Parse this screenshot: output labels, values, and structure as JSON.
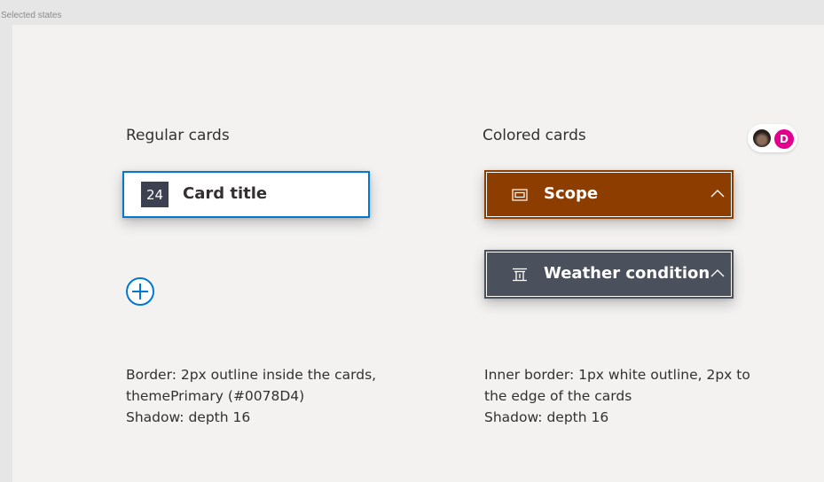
{
  "frame_label": "Selected states",
  "regular": {
    "heading": "Regular cards",
    "card": {
      "count": "24",
      "title": "Card title"
    },
    "notes": [
      "Border: 2px outline inside the cards,",
      "themePrimary (#0078D4)",
      "Shadow: depth 16"
    ]
  },
  "colored": {
    "heading": "Colored cards",
    "cards": [
      {
        "title": "Scope",
        "icon": "scope-icon",
        "color": "#8e3d00"
      },
      {
        "title": "Weather condition",
        "icon": "weather-icon",
        "color": "#4a505c"
      }
    ],
    "notes": [
      "Inner border: 1px white outline, 2px to",
      "the edge of the cards",
      "Shadow: depth 16"
    ]
  },
  "avatars": {
    "initial": "D",
    "initial_color": "#e3008c"
  },
  "colors": {
    "theme_primary": "#0078d4",
    "canvas": "#f3f2f1"
  }
}
